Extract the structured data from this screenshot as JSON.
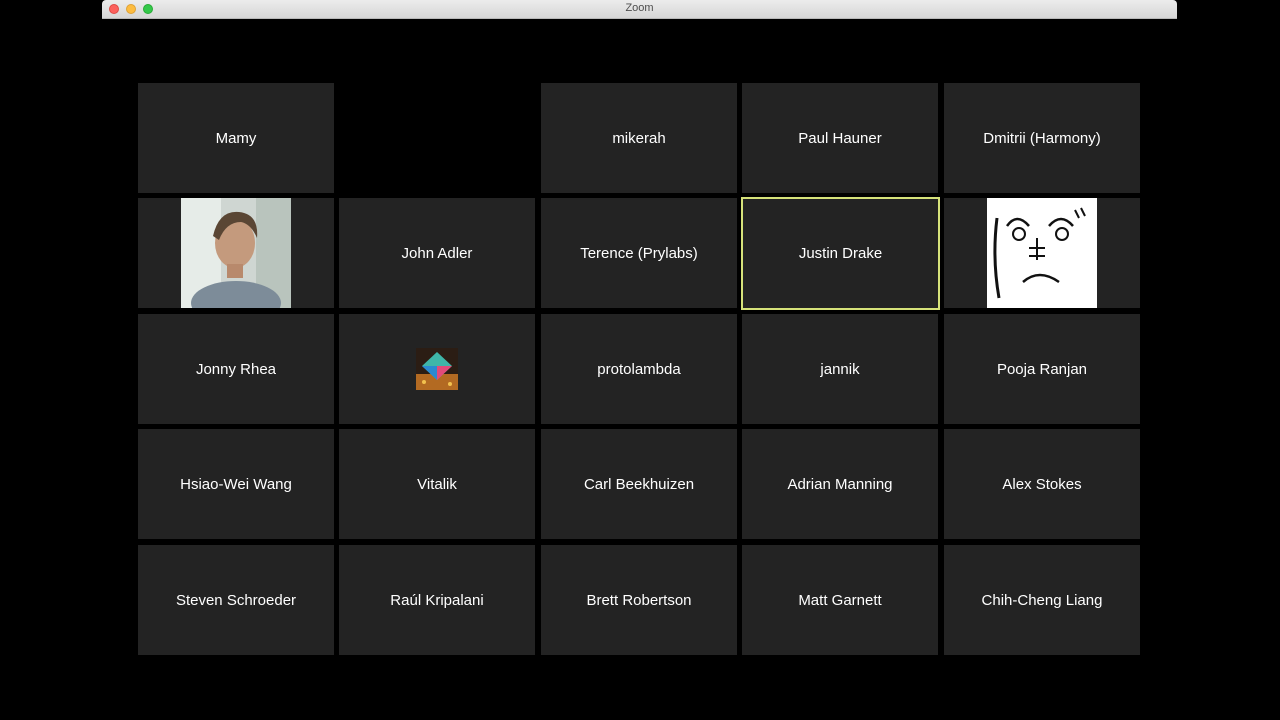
{
  "window": {
    "title": "Zoom"
  },
  "participants": [
    {
      "name": "Mamy"
    },
    {
      "name": "mikerah"
    },
    {
      "name": "Paul Hauner"
    },
    {
      "name": "Dmitrii (Harmony)"
    },
    {
      "name": "John Adler"
    },
    {
      "name": "Terence (Prylabs)"
    },
    {
      "name": "Justin Drake",
      "active_speaker": true
    },
    {
      "name": "Jonny Rhea"
    },
    {
      "name": "protolambda"
    },
    {
      "name": "jannik"
    },
    {
      "name": "Pooja Ranjan"
    },
    {
      "name": "Hsiao-Wei Wang"
    },
    {
      "name": "Vitalik"
    },
    {
      "name": "Carl Beekhuizen"
    },
    {
      "name": "Adrian Manning"
    },
    {
      "name": "Alex Stokes"
    },
    {
      "name": "Steven Schroeder"
    },
    {
      "name": "Raúl Kripalani"
    },
    {
      "name": "Brett Robertson"
    },
    {
      "name": "Matt Garnett"
    },
    {
      "name": "Chih-Cheng Liang"
    }
  ],
  "icons": {
    "photo_tile_1": "person-photo",
    "photo_tile_2": "face-drawing",
    "photo_tile_3": "geometric-avatar"
  },
  "colors": {
    "tile_bg": "#232323",
    "active_border": "#d6e27a",
    "background": "#000000"
  }
}
